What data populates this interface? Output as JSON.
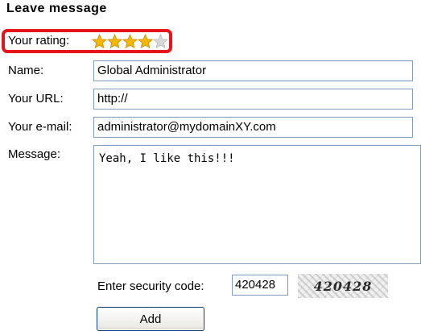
{
  "form": {
    "title": "Leave message",
    "rating": {
      "label": "Your rating:",
      "value": 4,
      "max": 5,
      "filled_color": "#f5b800",
      "empty_color": "#d8d8d8"
    },
    "name": {
      "label": "Name:",
      "value": "Global Administrator"
    },
    "url": {
      "label": "Your URL:",
      "value": "http://"
    },
    "email": {
      "label": "Your e-mail:",
      "value": "administrator@mydomainXY.com"
    },
    "message": {
      "label": "Message:",
      "value": "Yeah, I like this!!!"
    },
    "security": {
      "label": "Enter security code:",
      "value": "420428",
      "captcha_text": "420428"
    },
    "submit_label": "Add",
    "highlight_color": "#e8141b"
  }
}
